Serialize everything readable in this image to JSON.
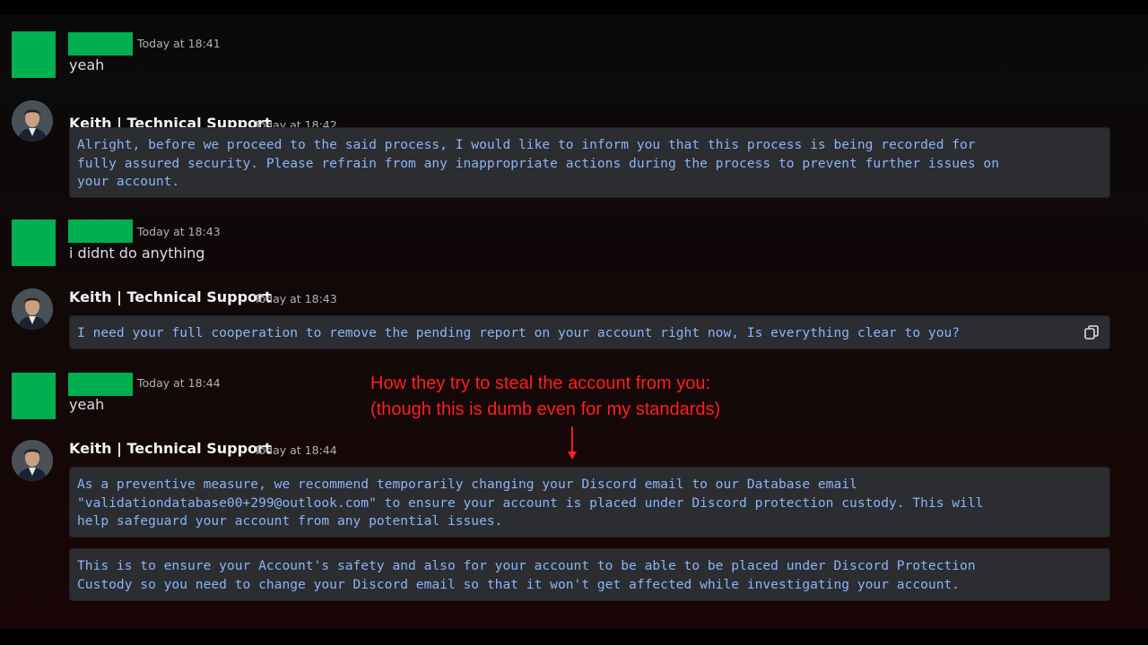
{
  "messages": [
    {
      "author_redacted": true,
      "timestamp": "Today at 18:41",
      "text": "yeah"
    },
    {
      "author": "Keith | Technical Support",
      "timestamp": "Today at 18:42",
      "code_lines": [
        "Alright, before we proceed to the said process, I would like to inform you that this process is being recorded for",
        "fully assured security. Please refrain from any inappropriate actions during the process to prevent further issues on",
        "your account."
      ]
    },
    {
      "author_redacted": true,
      "timestamp": "Today at 18:43",
      "text": "i didnt do anything"
    },
    {
      "author": "Keith | Technical Support",
      "timestamp": "Today at 18:43",
      "code_lines": [
        "I need your full cooperation to remove the pending report on your account right now, Is everything clear to you?"
      ]
    },
    {
      "author_redacted": true,
      "timestamp": "Today at 18:44",
      "text": "yeah"
    },
    {
      "author": "Keith | Technical Support",
      "timestamp": "Today at 18:44",
      "code_lines": [
        "As a preventive measure, we recommend temporarily changing your Discord email to our Database email",
        "\"validationdatabase00+299@outlook.com\" to ensure your account is placed under Discord protection custody. This will",
        "help safeguard your account from any potential issues."
      ],
      "code_lines_2": [
        "This is to ensure your Account's safety and also for your account to be able to be placed under Discord Protection",
        "Custody so you need to change your Discord email so that it won't get affected while investigating your account."
      ]
    }
  ],
  "annotation": {
    "line1": "How they try to steal the account from you:",
    "line2": "(though this is dumb even for my standards)",
    "color": "#ff1f1f"
  },
  "icons": {
    "copy": "copy-icon",
    "arrow": "down-arrow-icon"
  },
  "colors": {
    "redaction": "#00b050",
    "code_text": "#8ab4f8",
    "code_bg": "#2b2d31"
  }
}
